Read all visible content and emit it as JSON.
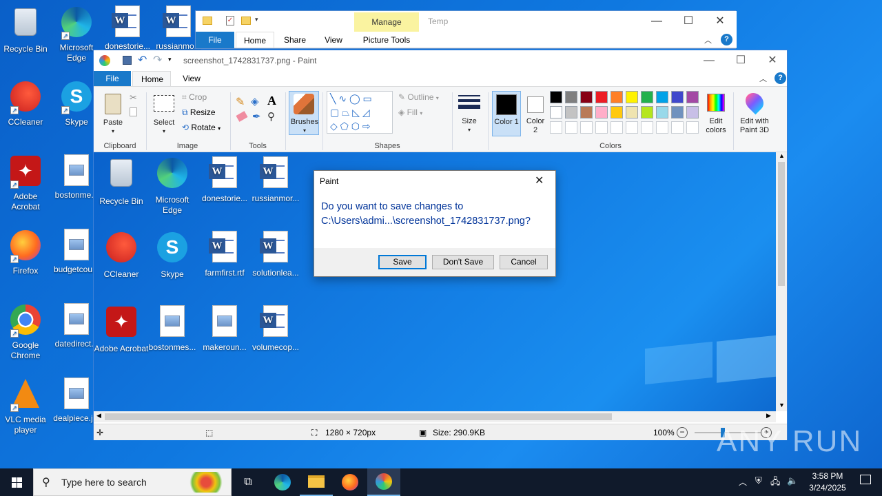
{
  "desktop": {
    "icons": [
      {
        "label": "Recycle Bin"
      },
      {
        "label": "Microsoft Edge"
      },
      {
        "label": "donestorie..."
      },
      {
        "label": "russianmo..."
      },
      {
        "label": "CCleaner"
      },
      {
        "label": "Skype"
      },
      {
        "label": "Adobe Acrobat"
      },
      {
        "label": "bostonme..."
      },
      {
        "label": "Firefox"
      },
      {
        "label": "budgetcou..."
      },
      {
        "label": "Google Chrome"
      },
      {
        "label": "datedirect..."
      },
      {
        "label": "VLC media player"
      },
      {
        "label": "dealpiece.j..."
      }
    ]
  },
  "explorer": {
    "title": "Temp",
    "manage_tab": "Manage",
    "tabs": [
      "File",
      "Home",
      "Share",
      "View",
      "Picture Tools"
    ]
  },
  "paint": {
    "title": "screenshot_1742831737.png - Paint",
    "tabs": [
      "File",
      "Home",
      "View"
    ],
    "clipboard": {
      "paste": "Paste",
      "label": "Clipboard"
    },
    "image": {
      "select": "Select",
      "crop": "Crop",
      "resize": "Resize",
      "rotate": "Rotate",
      "label": "Image"
    },
    "tools": {
      "label": "Tools"
    },
    "brushes": "Brushes",
    "shapes": {
      "outline": "Outline",
      "fill": "Fill",
      "label": "Shapes"
    },
    "size": "Size",
    "color1": "Color 1",
    "color2": "Color 2",
    "colors_label": "Colors",
    "edit_colors": "Edit colors",
    "edit_paint3d": "Edit with Paint 3D",
    "palette": [
      "#000000",
      "#7f7f7f",
      "#880015",
      "#ed1c24",
      "#ff7f27",
      "#fff200",
      "#22b14c",
      "#00a2e8",
      "#3f48cc",
      "#a349a4",
      "#ffffff",
      "#c3c3c3",
      "#b97a57",
      "#ffaec9",
      "#ffc90e",
      "#efe4b0",
      "#b5e61d",
      "#99d9ea",
      "#7092be",
      "#c8bfe7"
    ],
    "status": {
      "dimensions": "1280 × 720px",
      "size": "Size: 290.9KB",
      "zoom": "100%"
    },
    "canvas_icons": [
      {
        "label": "Recycle Bin"
      },
      {
        "label": "Microsoft Edge"
      },
      {
        "label": "donestorie..."
      },
      {
        "label": "russianmor..."
      },
      {
        "label": "CCleaner"
      },
      {
        "label": "Skype"
      },
      {
        "label": "farmfirst.rtf"
      },
      {
        "label": "solutionlea..."
      },
      {
        "label": "Adobe Acrobat"
      },
      {
        "label": "bostonmes..."
      },
      {
        "label": "makeroun..."
      },
      {
        "label": "volumecop..."
      }
    ]
  },
  "dialog": {
    "title": "Paint",
    "message_line1": "Do you want to save changes to",
    "message_line2": "C:\\Users\\admi...\\screenshot_1742831737.png?",
    "save": "Save",
    "dont_save": "Don't Save",
    "cancel": "Cancel"
  },
  "taskbar": {
    "search_placeholder": "Type here to search",
    "time": "3:58 PM",
    "date": "3/24/2025"
  },
  "watermark": "ANY RUN"
}
